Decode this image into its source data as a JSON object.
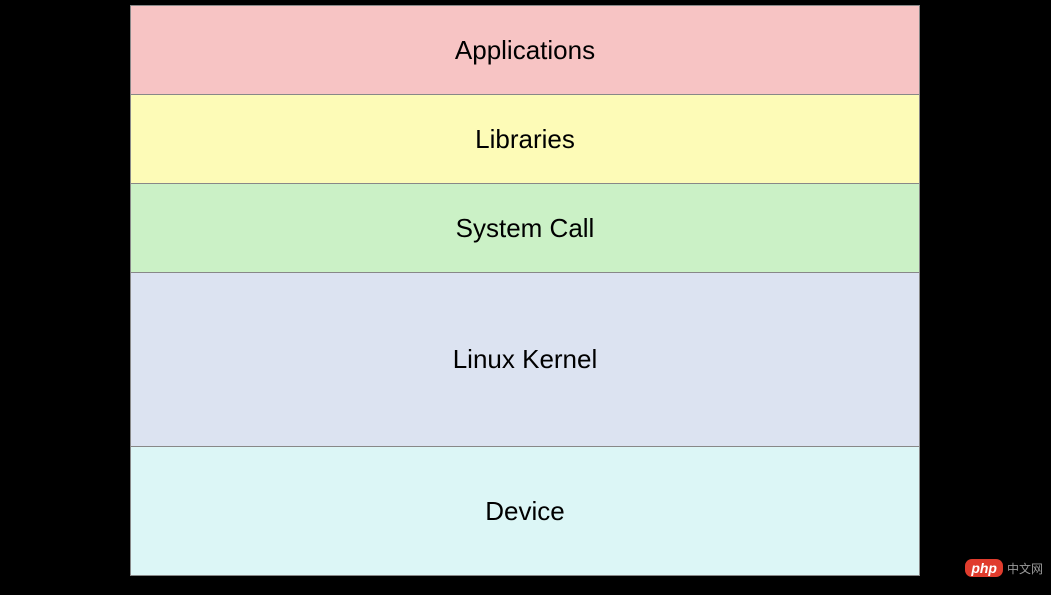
{
  "layers": {
    "applications": "Applications",
    "libraries": "Libraries",
    "systemcall": "System Call",
    "kernel": "Linux Kernel",
    "device": "Device"
  },
  "watermark": {
    "badge": "php",
    "text": "中文网"
  },
  "colors": {
    "applications": "#F7C4C4",
    "libraries": "#FDFBB7",
    "systemcall": "#CBF1C6",
    "kernel": "#DCE3F1",
    "device": "#DCF6F6",
    "border": "#888888",
    "background": "#000000"
  }
}
